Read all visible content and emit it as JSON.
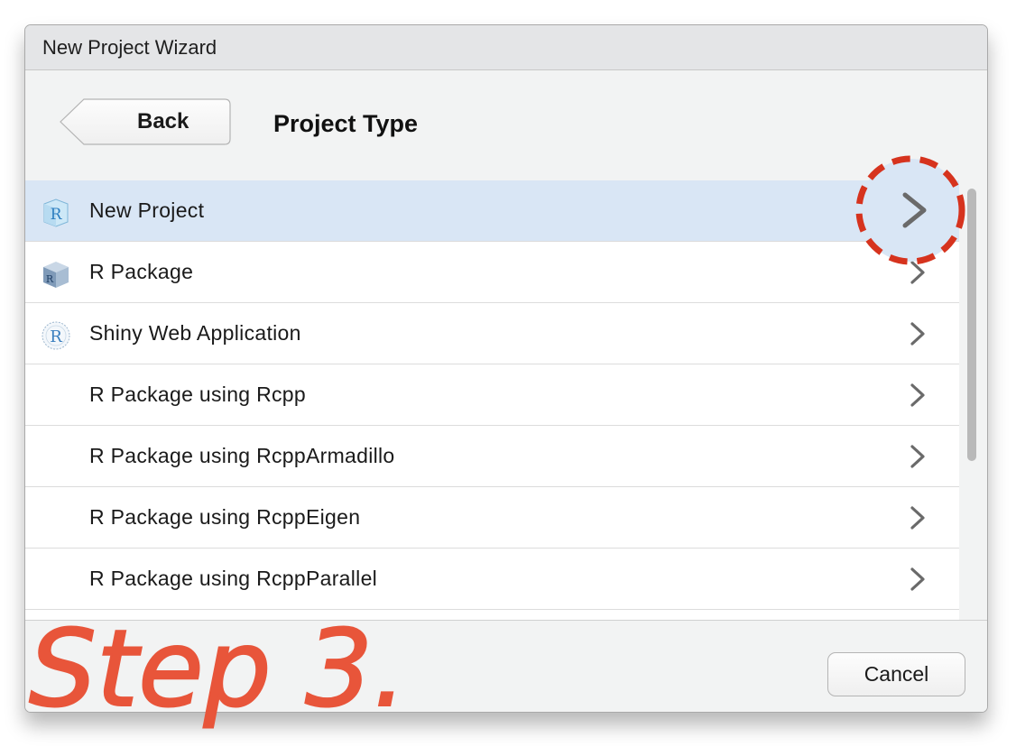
{
  "window": {
    "title": "New Project Wizard"
  },
  "header": {
    "back_label": "Back",
    "title": "Project Type"
  },
  "project_types": [
    {
      "label": "New Project",
      "icon": "r-project-icon",
      "selected": true
    },
    {
      "label": "R Package",
      "icon": "r-package-box-icon",
      "selected": false
    },
    {
      "label": "Shiny Web Application",
      "icon": "shiny-r-globe-icon",
      "selected": false
    },
    {
      "label": "R Package using Rcpp",
      "icon": null,
      "selected": false
    },
    {
      "label": "R Package using RcppArmadillo",
      "icon": null,
      "selected": false
    },
    {
      "label": "R Package using RcppEigen",
      "icon": null,
      "selected": false
    },
    {
      "label": "R Package using RcppParallel",
      "icon": null,
      "selected": false
    }
  ],
  "footer": {
    "cancel_label": "Cancel"
  },
  "annotation": {
    "text": "Step 3.",
    "color": "#e8553a"
  },
  "colors": {
    "selected_row": "#d9e6f5",
    "annotation_red": "#e8553a",
    "highlight_dash": "#d6331e",
    "highlight_fill": "#d9e6f5"
  }
}
